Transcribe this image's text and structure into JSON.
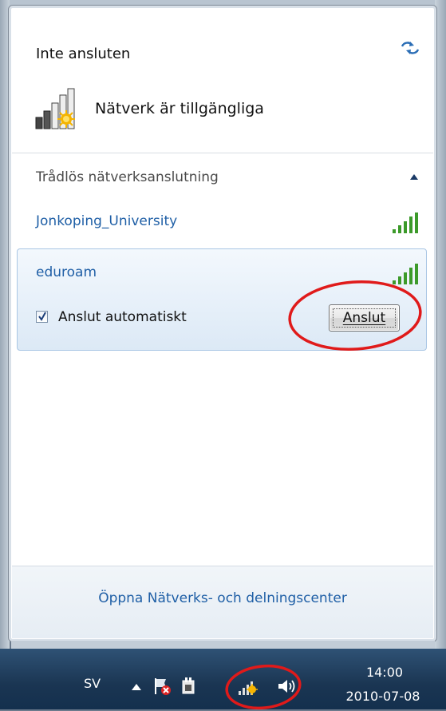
{
  "flyout": {
    "status": "Inte ansluten",
    "networks_available": "Nätverk är tillgängliga",
    "section_header": "Trådlös nätverksanslutning",
    "networks": [
      {
        "name": "Jonkoping_University",
        "signal": "excellent"
      },
      {
        "name": "eduroam",
        "signal": "excellent",
        "selected": true
      }
    ],
    "auto_connect_label": "Anslut automatiskt",
    "auto_connect_checked": true,
    "connect_button": "Anslut",
    "footer_link": "Öppna Nätverks- och delningscenter"
  },
  "taskbar": {
    "language": "SV",
    "time": "14:00",
    "date": "2010-07-08"
  },
  "icons": {
    "refresh": "refresh-icon",
    "network_status": "wireless-available-icon",
    "collapse": "chevron-up-icon",
    "signal": "signal-strength-icon"
  },
  "colors": {
    "link_blue": "#1f5fa6",
    "selection_border": "#a9c6e4",
    "taskbar": "#1a3552",
    "annotation_red": "#e01a1a"
  }
}
